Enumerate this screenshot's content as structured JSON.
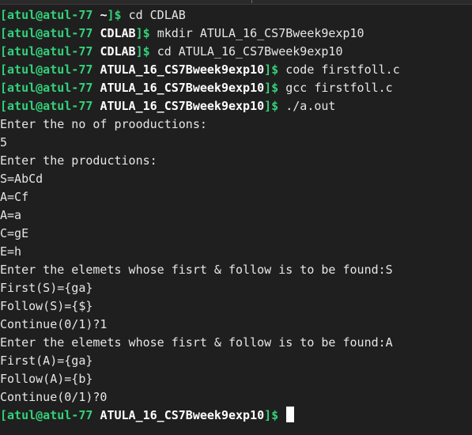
{
  "prompt": {
    "user_host": "[atul@atul-77",
    "dollar": "]$"
  },
  "commands": [
    {
      "dir": "~",
      "cmd": "cd CDLAB"
    },
    {
      "dir": "CDLAB",
      "cmd": "mkdir ATULA_16_CS7Bweek9exp10"
    },
    {
      "dir": "CDLAB",
      "cmd": "cd ATULA_16_CS7Bweek9exp10"
    },
    {
      "dir": "ATULA_16_CS7Bweek9exp10",
      "cmd": "code firstfoll.c"
    },
    {
      "dir": "ATULA_16_CS7Bweek9exp10",
      "cmd": "gcc firstfoll.c"
    },
    {
      "dir": "ATULA_16_CS7Bweek9exp10",
      "cmd": "./a.out"
    }
  ],
  "output": [
    "Enter the no of prooductions:",
    "5",
    "Enter the productions:",
    "S=AbCd",
    "A=Cf",
    "A=a",
    "C=gE",
    "E=h",
    "Enter the elemets whose fisrt & follow is to be found:S",
    "First(S)={ga}",
    "Follow(S)={$}",
    "Continue(0/1)?1",
    "Enter the elemets whose fisrt & follow is to be found:A",
    "First(A)={ga}",
    "Follow(A)={b}",
    "Continue(0/1)?0"
  ],
  "final_prompt": {
    "dir": "ATULA_16_CS7Bweek9exp10"
  },
  "colors": {
    "background": "#1f1f1f",
    "prompt_green": "#33d17a",
    "text": "#e6e6e6"
  }
}
